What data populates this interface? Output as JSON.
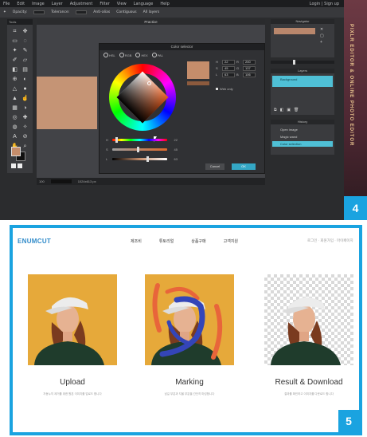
{
  "editor": {
    "menu": [
      "File",
      "Edit",
      "Image",
      "Layer",
      "Adjustment",
      "Filter",
      "View",
      "Language",
      "Help"
    ],
    "login": "Login | Sign up",
    "options": {
      "opacity_label": "Opacity:",
      "opacity_value": "100",
      "tolerance_label": "Tolerance:",
      "tolerance_value": "32",
      "antialias": "Anti-alias",
      "contiguous": "Contiguous",
      "all_layers": "All layers"
    },
    "tools_label": "Tools",
    "canvas_title": "Practice",
    "status_zoom": "100",
    "status_size": "1024x613 px",
    "color_dialog": {
      "title": "Color selector",
      "modes": [
        "HSL",
        "RGB",
        "HEX",
        "PAL"
      ],
      "sliders": [
        {
          "label": "H",
          "value": "22"
        },
        {
          "label": "S",
          "value": "45"
        },
        {
          "label": "L",
          "value": "63"
        }
      ],
      "fields": [
        {
          "label": "H",
          "value": "22"
        },
        {
          "label": "R",
          "value": "200"
        },
        {
          "label": "S",
          "value": "45"
        },
        {
          "label": "G",
          "value": "137"
        },
        {
          "label": "L",
          "value": "63"
        },
        {
          "label": "B",
          "value": "106"
        }
      ],
      "web_only": "Web only",
      "cancel_label": "Cancel",
      "ok_label": "OK",
      "preview_color": "#c58d6b"
    },
    "navigator_title": "Navigator",
    "layers_title": "Layers",
    "layer_name": "Background",
    "history_title": "History",
    "history_items": [
      "Open image",
      "Magic wand",
      "Color selection"
    ],
    "banner_text": "PIXLR EDITOR & ONLINE PHOTO EDITOR",
    "badge": "4"
  },
  "website": {
    "logo": "ENUMCUT",
    "nav": [
      "제조비",
      "튜토리얼",
      "상품구매",
      "고객지원"
    ],
    "topright": "로그인 · 회원가입 · 마이페이지",
    "steps": [
      {
        "title": "Upload",
        "desc": "자동누끼 제거를 위한 원본 이미지를 업로드 합니다"
      },
      {
        "title": "Marking",
        "desc": "남길 부분과 지울 부분을 간단히 마킹합니다"
      },
      {
        "title": "Result & Download",
        "desc": "결과를 확인하고 이미지를 다운로드 합니다"
      }
    ],
    "badge": "5",
    "colors": {
      "accent": "#1aa3e0",
      "keep_mark": "#e8653a",
      "remove_mark": "#3445b8",
      "wall": "#e6a93a"
    }
  }
}
